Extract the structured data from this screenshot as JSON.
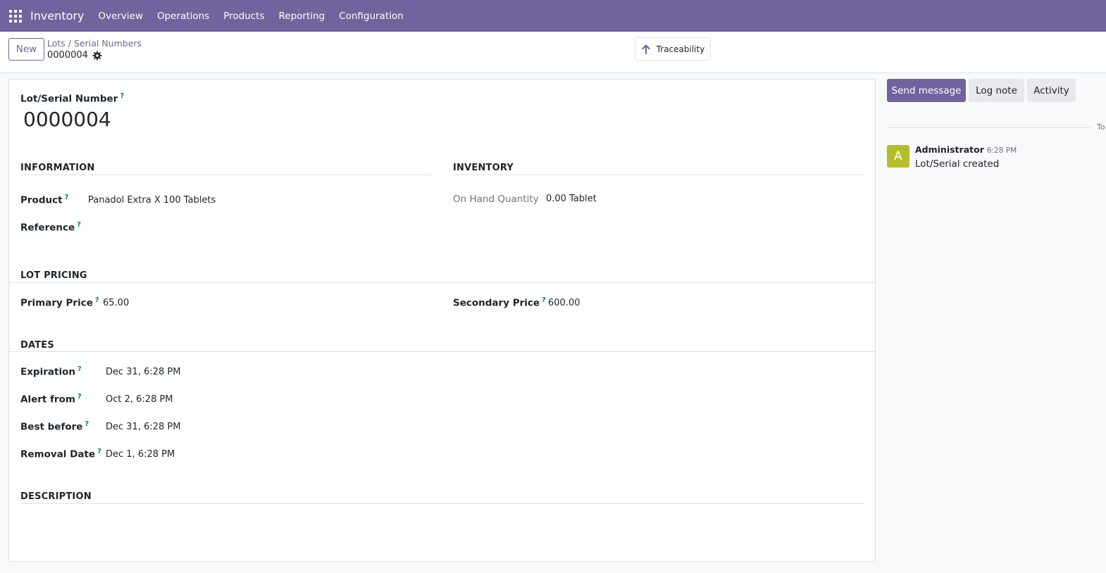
{
  "navbar": {
    "app_name": "Inventory",
    "menu": [
      "Overview",
      "Operations",
      "Products",
      "Reporting",
      "Configuration"
    ]
  },
  "control": {
    "new_label": "New",
    "breadcrumb": "Lots / Serial Numbers",
    "record": "0000004",
    "traceability_label": "Traceability"
  },
  "form": {
    "lot_label": "Lot/Serial Number",
    "lot_value": "0000004",
    "help_mark": "?",
    "information": {
      "title": "INFORMATION",
      "product_label": "Product",
      "product_value": "Panadol Extra X 100 Tablets",
      "reference_label": "Reference"
    },
    "inventory": {
      "title": "INVENTORY",
      "onhand_label": "On Hand Quantity",
      "onhand_value": "0.00 Tablet"
    },
    "pricing": {
      "title": "LOT PRICING",
      "primary_label": "Primary Price",
      "primary_value": "65.00",
      "secondary_label": "Secondary Price",
      "secondary_value": "600.00"
    },
    "dates": {
      "title": "DATES",
      "expiration_label": "Expiration",
      "expiration_value": "Dec 31, 6:28 PM",
      "alert_label": "Alert from",
      "alert_value": "Oct 2, 6:28 PM",
      "best_label": "Best before",
      "best_value": "Dec 31, 6:28 PM",
      "removal_label": "Removal Date",
      "removal_value": "Dec 1, 6:28 PM"
    },
    "description": {
      "title": "DESCRIPTION"
    }
  },
  "chatter": {
    "send_label": "Send message",
    "log_label": "Log note",
    "activity_label": "Activity",
    "separator_label": "To",
    "message": {
      "avatar_letter": "A",
      "author": "Administrator",
      "time": "6:28 PM",
      "body": "Lot/Serial created"
    }
  },
  "colors": {
    "brand": "#71639e",
    "help": "#017e84",
    "avatar": "#b5bd2c"
  }
}
